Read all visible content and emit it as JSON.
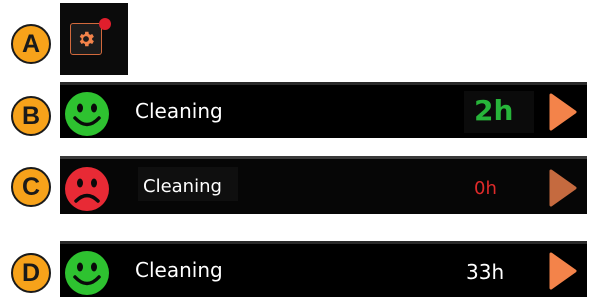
{
  "badges": {
    "a": "A",
    "b": "B",
    "c": "C",
    "d": "D"
  },
  "icons": {
    "settings": "gear-icon",
    "notification": "red-dot",
    "good": "smiley-happy-icon",
    "bad": "smiley-sad-icon",
    "go": "play-arrow-icon"
  },
  "colors": {
    "badge": "#f7a21a",
    "good_green": "#2ec230",
    "bad_red": "#e82a35",
    "arrow_orange": "#f3834a",
    "value_green": "#27b53a",
    "value_red": "#e02a2a"
  },
  "rows": [
    {
      "label": "Cleaning",
      "value": "2h",
      "status": "good"
    },
    {
      "label": "Cleaning",
      "value": "0h",
      "status": "bad"
    },
    {
      "label": "Cleaning",
      "value": "33h",
      "status": "good"
    }
  ]
}
